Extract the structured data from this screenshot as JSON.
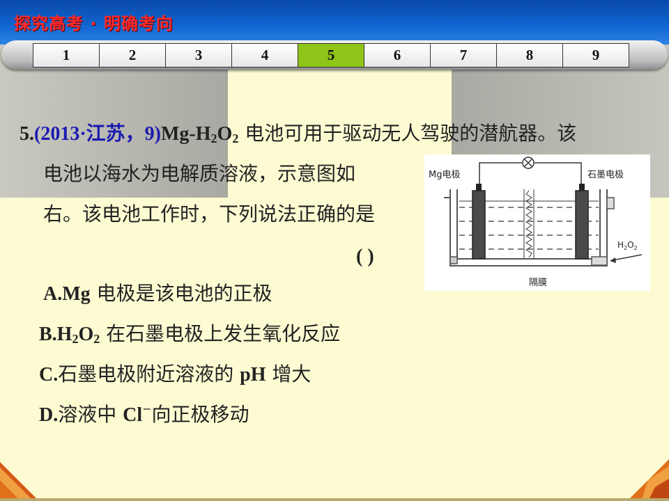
{
  "header": {
    "title": "探究高考 · 明确考向"
  },
  "nav": {
    "tabs": [
      "1",
      "2",
      "3",
      "4",
      "5",
      "6",
      "7",
      "8",
      "9"
    ],
    "active_index": 4,
    "active_color": "#8fc519"
  },
  "question": {
    "number": "5.",
    "source": "(2013·江苏，9)",
    "stem_part1_a": "Mg-H",
    "stem_part1_sub1": "2",
    "stem_part1_b": "O",
    "stem_part1_sub2": "2",
    "stem_part1_c": " 电池可用于驱动无人驾驶的潜航器。该",
    "stem_line2": "电池以海水为电解质溶液，示意图如",
    "stem_line3": "右。该电池工作时，下列说法正确的是",
    "answer_blank": "(        )"
  },
  "options": {
    "a_label": "A.Mg",
    "a_text": " 电极是该电池的正极",
    "b_label_a": "B.H",
    "b_sub1": "2",
    "b_label_b": "O",
    "b_sub2": "2",
    "b_text": " 在石墨电极上发生氧化反应",
    "c_label": "C.",
    "c_text": "石墨电极附近溶液的 ",
    "c_ph": "pH",
    "c_text2": " 增大",
    "d_label": "D.",
    "d_text": "溶液中 ",
    "d_cl": "Cl",
    "d_sup": "−",
    "d_text2": "向正极移动"
  },
  "diagram": {
    "mg_electrode_label": "Mg电极",
    "graphite_electrode_label": "石墨电极",
    "inlet_label_a": "H",
    "inlet_sub1": "2",
    "inlet_label_b": "O",
    "inlet_sub2": "2",
    "membrane_label": "隔膜",
    "bulb_icon": "lamp-icon"
  }
}
